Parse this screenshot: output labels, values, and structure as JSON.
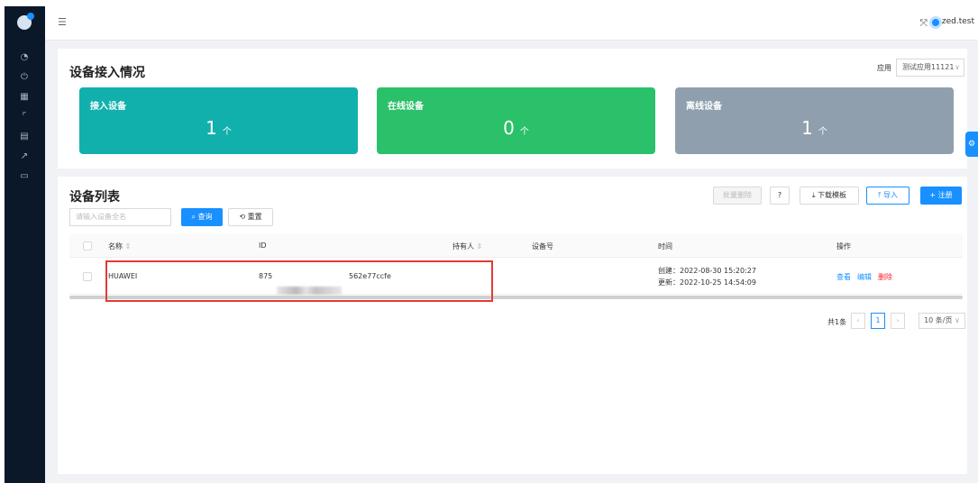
{
  "header": {
    "username": "zed.test"
  },
  "overview": {
    "title": "设备接入情况",
    "app_label": "应用",
    "app_selected": "测试应用11121",
    "cards": [
      {
        "label": "接入设备",
        "count": "1",
        "unit": "个",
        "color": "#12b0ad"
      },
      {
        "label": "在线设备",
        "count": "0",
        "unit": "个",
        "color": "#2bc06a"
      },
      {
        "label": "离线设备",
        "count": "1",
        "unit": "个",
        "color": "#8f9fae"
      }
    ]
  },
  "device_list": {
    "title": "设备列表",
    "search_placeholder": "请输入设备全名",
    "query_label": "查询",
    "reset_label": "重置",
    "batch_delete_label": "批量删除",
    "download_template_label": "下载模板",
    "import_label": "导入",
    "register_label": "+ 注册",
    "columns": {
      "name": "名称",
      "id": "ID",
      "holder": "持有人",
      "device_no": "设备号",
      "time": "时间",
      "actions": "操作"
    },
    "rows": [
      {
        "name": "HUAWEI",
        "id_prefix": "875",
        "id_suffix": "562e77ccfe",
        "holder": "",
        "device_no": "",
        "created": "创建：2022-08-30 15:20:27",
        "updated": "更新：2022-10-25 14:54:09",
        "view_label": "查看",
        "edit_label": "编辑",
        "delete_label": "删除"
      }
    ]
  },
  "pagination": {
    "total": "共1条",
    "current_page": "1",
    "page_size": "10 条/页"
  },
  "colors": {
    "accent": "#1890ff",
    "danger": "#f5222d",
    "sidebar": "#0b1829",
    "highlight_box": "#e53935"
  }
}
